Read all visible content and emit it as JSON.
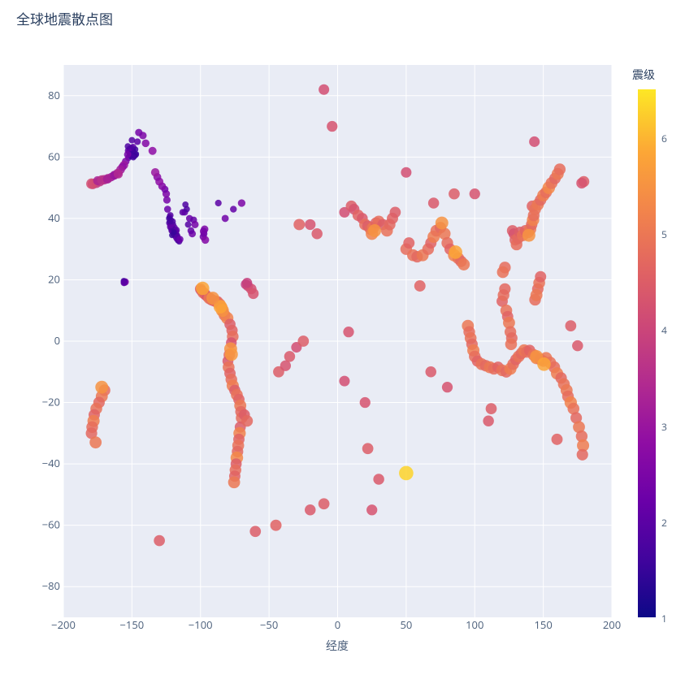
{
  "chart_data": {
    "type": "scatter",
    "title": "全球地震散点图",
    "xlabel": "经度",
    "ylabel": "",
    "xlim": [
      -200,
      200
    ],
    "ylim": [
      -90,
      90
    ],
    "xticks": [
      -200,
      -150,
      -100,
      -50,
      0,
      50,
      100,
      150,
      200
    ],
    "yticks": [
      -80,
      -60,
      -40,
      -20,
      0,
      20,
      40,
      60,
      80
    ],
    "color_axis": {
      "label": "震级",
      "min": 1,
      "max": 6.5,
      "ticks": [
        1,
        2,
        3,
        4,
        5,
        6
      ],
      "scale": "plasma"
    },
    "points": [
      [
        -149.9,
        60.5,
        1.5
      ],
      [
        -150.4,
        61.2,
        1.7
      ],
      [
        -148.3,
        60.1,
        1.3
      ],
      [
        -151.2,
        61.5,
        1.9
      ],
      [
        -152.5,
        59.8,
        2.0
      ],
      [
        -146.8,
        61.0,
        1.4
      ],
      [
        -150.1,
        62.3,
        1.8
      ],
      [
        -151.7,
        60.9,
        1.7
      ],
      [
        -149.2,
        63.2,
        2.1
      ],
      [
        -147.5,
        62.5,
        1.6
      ],
      [
        -152.0,
        61.8,
        1.9
      ],
      [
        -150.8,
        60.2,
        1.4
      ],
      [
        -148.9,
        61.9,
        1.5
      ],
      [
        -151.5,
        62.7,
        2.0
      ],
      [
        -149.6,
        61.3,
        1.7
      ],
      [
        -147.1,
        60.7,
        1.6
      ],
      [
        -150.3,
        63.0,
        1.8
      ],
      [
        -152.7,
        62.1,
        2.1
      ],
      [
        -148.0,
        60.4,
        1.5
      ],
      [
        -151.0,
        61.0,
        1.6
      ],
      [
        -153.1,
        60.8,
        2.4
      ],
      [
        -149.0,
        59.9,
        1.7
      ],
      [
        -154.5,
        58.6,
        2.5
      ],
      [
        -155.8,
        57.4,
        3.0
      ],
      [
        -156.9,
        56.8,
        2.8
      ],
      [
        -158.3,
        55.9,
        3.1
      ],
      [
        -160.5,
        54.7,
        3.3
      ],
      [
        -162.8,
        54.1,
        3.2
      ],
      [
        -165.0,
        53.5,
        3.0
      ],
      [
        -167.4,
        53.0,
        3.4
      ],
      [
        -170.2,
        52.6,
        3.6
      ],
      [
        -173.5,
        52.0,
        3.7
      ],
      [
        -176.0,
        51.5,
        3.8
      ],
      [
        -178.5,
        51.2,
        4.0
      ],
      [
        -179.5,
        51.3,
        4.2
      ],
      [
        -175.0,
        52.3,
        3.3
      ],
      [
        -172.0,
        52.5,
        3.6
      ],
      [
        -168.0,
        52.8,
        3.2
      ],
      [
        -163.0,
        54.0,
        3.0
      ],
      [
        -160.0,
        54.5,
        3.4
      ],
      [
        -155.0,
        19.3,
        2.5
      ],
      [
        -155.3,
        19.4,
        1.8
      ],
      [
        -155.5,
        19.2,
        2.2
      ],
      [
        -156.0,
        19.6,
        1.7
      ],
      [
        -155.8,
        19.0,
        2.0
      ],
      [
        -120.5,
        35.8,
        1.5
      ],
      [
        -121.2,
        36.5,
        1.8
      ],
      [
        -122.0,
        37.2,
        2.0
      ],
      [
        -119.5,
        34.8,
        1.7
      ],
      [
        -118.0,
        34.0,
        1.9
      ],
      [
        -117.2,
        33.5,
        2.2
      ],
      [
        -116.5,
        32.8,
        1.6
      ],
      [
        -118.5,
        36.0,
        2.1
      ],
      [
        -120.0,
        38.0,
        1.8
      ],
      [
        -121.5,
        39.5,
        1.5
      ],
      [
        -122.5,
        40.5,
        1.7
      ],
      [
        -117.0,
        34.5,
        1.6
      ],
      [
        -119.0,
        37.0,
        2.0
      ],
      [
        -121.0,
        36.0,
        1.9
      ],
      [
        -122.8,
        38.5,
        1.8
      ],
      [
        -116.0,
        33.0,
        2.0
      ],
      [
        -117.8,
        35.5,
        1.7
      ],
      [
        -120.8,
        34.5,
        1.5
      ],
      [
        -122.0,
        41.0,
        1.9
      ],
      [
        -123.0,
        40.0,
        1.6
      ],
      [
        -115.5,
        32.5,
        1.8
      ],
      [
        -119.8,
        36.5,
        1.7
      ],
      [
        -121.8,
        37.8,
        2.1
      ],
      [
        -118.8,
        35.0,
        1.6
      ],
      [
        -120.3,
        39.0,
        1.8
      ],
      [
        -117.5,
        36.2,
        2.0
      ],
      [
        -116.8,
        34.0,
        1.9
      ],
      [
        -122.3,
        39.0,
        1.7
      ],
      [
        -115.0,
        33.2,
        2.2
      ],
      [
        -119.3,
        35.5,
        1.5
      ],
      [
        -111.0,
        44.5,
        1.8
      ],
      [
        -113.0,
        42.0,
        2.0
      ],
      [
        -108.0,
        40.0,
        2.2
      ],
      [
        -105.0,
        39.5,
        2.1
      ],
      [
        -109.0,
        38.0,
        1.9
      ],
      [
        -111.5,
        42.0,
        2.0
      ],
      [
        -106.0,
        35.0,
        2.3
      ],
      [
        -107.0,
        36.0,
        2.1
      ],
      [
        -104.0,
        38.0,
        2.4
      ],
      [
        -110.0,
        43.0,
        1.8
      ],
      [
        -97.5,
        35.0,
        2.2
      ],
      [
        -97.0,
        36.5,
        2.5
      ],
      [
        -98.0,
        34.0,
        2.3
      ],
      [
        -96.5,
        33.0,
        2.6
      ],
      [
        -97.8,
        35.8,
        2.4
      ],
      [
        -87.0,
        45.0,
        2.0
      ],
      [
        -82.0,
        40.0,
        2.3
      ],
      [
        -76.0,
        43.0,
        2.1
      ],
      [
        -70.0,
        45.0,
        2.5
      ],
      [
        -100.0,
        17.0,
        4.5
      ],
      [
        -99.5,
        16.5,
        4.2
      ],
      [
        -98.0,
        15.8,
        4.8
      ],
      [
        -96.5,
        15.2,
        4.6
      ],
      [
        -95.0,
        14.5,
        4.3
      ],
      [
        -93.5,
        14.0,
        5.0
      ],
      [
        -92.0,
        13.5,
        4.7
      ],
      [
        -90.5,
        13.2,
        4.5
      ],
      [
        -89.0,
        13.0,
        4.8
      ],
      [
        -87.5,
        12.8,
        4.6
      ],
      [
        -86.0,
        12.0,
        4.9
      ],
      [
        -84.5,
        11.0,
        4.7
      ],
      [
        -83.5,
        9.5,
        4.4
      ],
      [
        -82.5,
        8.5,
        4.8
      ],
      [
        -80.5,
        7.5,
        5.2
      ],
      [
        -78.5,
        5.5,
        4.5
      ],
      [
        -77.0,
        3.5,
        4.6
      ],
      [
        -76.5,
        1.5,
        4.8
      ],
      [
        -77.5,
        -0.5,
        4.3
      ],
      [
        -78.0,
        -2.5,
        5.5
      ],
      [
        -79.0,
        -4.5,
        4.7
      ],
      [
        -80.0,
        -6.5,
        4.4
      ],
      [
        -79.5,
        -8.5,
        4.9
      ],
      [
        -78.5,
        -10.5,
        4.6
      ],
      [
        -77.5,
        -12.5,
        4.8
      ],
      [
        -76.5,
        -14.5,
        5.1
      ],
      [
        -75.0,
        -16.0,
        4.5
      ],
      [
        -73.5,
        -17.5,
        4.9
      ],
      [
        -72.0,
        -19.0,
        4.6
      ],
      [
        -71.0,
        -21.0,
        5.0
      ],
      [
        -70.5,
        -23.0,
        4.7
      ],
      [
        -70.0,
        -25.0,
        4.8
      ],
      [
        -71.0,
        -28.0,
        4.5
      ],
      [
        -71.5,
        -30.0,
        5.2
      ],
      [
        -72.0,
        -32.0,
        4.6
      ],
      [
        -72.5,
        -34.0,
        4.9
      ],
      [
        -73.0,
        -36.0,
        4.7
      ],
      [
        -73.5,
        -38.0,
        5.3
      ],
      [
        -74.0,
        -40.0,
        4.5
      ],
      [
        -74.5,
        -42.0,
        4.8
      ],
      [
        -75.0,
        -44.0,
        4.6
      ],
      [
        -75.5,
        -46.0,
        5.0
      ],
      [
        -68.0,
        -24.0,
        4.5
      ],
      [
        -66.0,
        -26.0,
        4.7
      ],
      [
        -84.0,
        10.0,
        5.5
      ],
      [
        -85.5,
        11.2,
        5.8
      ],
      [
        -91.0,
        14.0,
        5.5
      ],
      [
        -98.5,
        17.2,
        5.8
      ],
      [
        -77.5,
        -4.3,
        5.6
      ],
      [
        -67.0,
        18.5,
        3.8
      ],
      [
        -65.5,
        18.0,
        4.0
      ],
      [
        -63.0,
        17.0,
        4.2
      ],
      [
        -61.5,
        15.5,
        4.3
      ],
      [
        -66.0,
        19.0,
        3.9
      ],
      [
        -43.0,
        -10.0,
        4.5
      ],
      [
        -38.0,
        -8.0,
        4.3
      ],
      [
        -35.0,
        -5.0,
        4.4
      ],
      [
        -30.0,
        -2.0,
        4.2
      ],
      [
        -25.0,
        0.0,
        4.5
      ],
      [
        -28.0,
        38.0,
        4.6
      ],
      [
        -20.0,
        38.0,
        4.3
      ],
      [
        -15.0,
        35.0,
        4.4
      ],
      [
        -10.0,
        82.0,
        4.2
      ],
      [
        -4.0,
        70.0,
        4.3
      ],
      [
        5.0,
        42.0,
        4.2
      ],
      [
        10.0,
        44.0,
        4.5
      ],
      [
        12.0,
        43.0,
        4.3
      ],
      [
        15.0,
        41.0,
        4.6
      ],
      [
        18.0,
        40.0,
        4.4
      ],
      [
        20.0,
        38.0,
        4.8
      ],
      [
        22.0,
        37.5,
        4.5
      ],
      [
        24.0,
        36.5,
        4.7
      ],
      [
        26.0,
        37.0,
        5.0
      ],
      [
        28.0,
        38.5,
        4.6
      ],
      [
        30.0,
        39.0,
        4.8
      ],
      [
        33.0,
        38.0,
        4.5
      ],
      [
        36.0,
        36.0,
        4.9
      ],
      [
        38.0,
        38.0,
        4.7
      ],
      [
        40.0,
        40.0,
        4.6
      ],
      [
        42.0,
        42.0,
        4.5
      ],
      [
        25.0,
        35.0,
        5.2
      ],
      [
        27.0,
        36.0,
        5.5
      ],
      [
        8.0,
        3.0,
        4.3
      ],
      [
        5.0,
        -13.0,
        4.2
      ],
      [
        20.0,
        -20.0,
        4.3
      ],
      [
        22.0,
        -35.0,
        4.5
      ],
      [
        30.0,
        -45.0,
        4.4
      ],
      [
        25.0,
        -55.0,
        4.3
      ],
      [
        -10.0,
        -53.0,
        4.5
      ],
      [
        -20.0,
        -55.0,
        4.4
      ],
      [
        -45.0,
        -60.0,
        4.6
      ],
      [
        -60.0,
        -62.0,
        4.5
      ],
      [
        50.0,
        30.0,
        4.8
      ],
      [
        52.0,
        32.0,
        4.6
      ],
      [
        55.0,
        28.0,
        4.9
      ],
      [
        58.0,
        27.5,
        4.7
      ],
      [
        62.0,
        28.0,
        5.0
      ],
      [
        66.0,
        30.0,
        4.8
      ],
      [
        68.0,
        32.0,
        4.6
      ],
      [
        70.0,
        34.0,
        5.1
      ],
      [
        72.0,
        36.0,
        4.9
      ],
      [
        75.0,
        37.0,
        4.7
      ],
      [
        78.0,
        35.0,
        5.0
      ],
      [
        80.0,
        32.0,
        4.8
      ],
      [
        82.0,
        30.0,
        4.6
      ],
      [
        85.0,
        28.0,
        5.2
      ],
      [
        88.0,
        27.0,
        4.9
      ],
      [
        90.0,
        26.0,
        4.7
      ],
      [
        92.0,
        25.0,
        5.0
      ],
      [
        76.0,
        38.5,
        5.5
      ],
      [
        86.0,
        29.0,
        5.8
      ],
      [
        95.0,
        5.0,
        5.0
      ],
      [
        96.0,
        3.0,
        4.8
      ],
      [
        97.0,
        1.0,
        4.9
      ],
      [
        98.0,
        -1.0,
        4.7
      ],
      [
        99.0,
        -3.0,
        5.1
      ],
      [
        100.0,
        -5.0,
        4.8
      ],
      [
        102.0,
        -6.5,
        4.6
      ],
      [
        105.0,
        -7.5,
        4.9
      ],
      [
        108.0,
        -8.0,
        4.7
      ],
      [
        111.0,
        -8.5,
        5.0
      ],
      [
        114.0,
        -9.0,
        4.8
      ],
      [
        117.0,
        -8.5,
        4.6
      ],
      [
        120.0,
        -9.5,
        4.9
      ],
      [
        123.0,
        -10.0,
        4.7
      ],
      [
        126.0,
        -9.0,
        5.1
      ],
      [
        128.0,
        -7.5,
        4.8
      ],
      [
        130.0,
        -6.0,
        4.6
      ],
      [
        132.0,
        -5.0,
        4.9
      ],
      [
        134.0,
        -4.0,
        4.7
      ],
      [
        136.0,
        -3.0,
        5.0
      ],
      [
        138.0,
        -3.5,
        4.8
      ],
      [
        140.0,
        -3.0,
        4.6
      ],
      [
        143.0,
        -4.5,
        4.9
      ],
      [
        145.0,
        -5.5,
        5.2
      ],
      [
        148.0,
        -6.0,
        4.8
      ],
      [
        150.0,
        -6.5,
        4.7
      ],
      [
        152.0,
        -5.5,
        5.0
      ],
      [
        155.0,
        -7.0,
        4.9
      ],
      [
        158.0,
        -8.5,
        4.8
      ],
      [
        160.0,
        -10.5,
        5.1
      ],
      [
        163.0,
        -12.0,
        4.7
      ],
      [
        165.0,
        -14.0,
        4.9
      ],
      [
        167.0,
        -16.0,
        5.0
      ],
      [
        168.0,
        -18.0,
        4.8
      ],
      [
        170.0,
        -20.0,
        5.2
      ],
      [
        172.0,
        -22.0,
        4.9
      ],
      [
        174.0,
        -25.0,
        4.7
      ],
      [
        176.0,
        -28.0,
        5.0
      ],
      [
        145.0,
        -5.0,
        5.5
      ],
      [
        150.5,
        -7.5,
        5.8
      ],
      [
        178.0,
        -31.0,
        4.8
      ],
      [
        179.0,
        -34.0,
        5.1
      ],
      [
        178.5,
        -37.0,
        4.7
      ],
      [
        122.0,
        24.0,
        4.8
      ],
      [
        120.0,
        13.0,
        4.6
      ],
      [
        121.0,
        15.0,
        4.8
      ],
      [
        122.0,
        17.0,
        4.7
      ],
      [
        123.0,
        10.0,
        4.9
      ],
      [
        124.0,
        8.0,
        4.6
      ],
      [
        125.0,
        6.0,
        5.0
      ],
      [
        126.0,
        3.0,
        4.8
      ],
      [
        127.0,
        1.0,
        4.7
      ],
      [
        126.5,
        -1.0,
        4.9
      ],
      [
        120.5,
        22.5,
        4.9
      ],
      [
        127.5,
        36.0,
        4.5
      ],
      [
        128.5,
        35.0,
        4.3
      ],
      [
        129.5,
        33.0,
        4.6
      ],
      [
        130.5,
        31.5,
        4.8
      ],
      [
        131.5,
        33.5,
        4.7
      ],
      [
        133.0,
        35.5,
        4.5
      ],
      [
        135.0,
        34.5,
        4.9
      ],
      [
        137.0,
        36.0,
        4.6
      ],
      [
        139.0,
        35.5,
        4.8
      ],
      [
        140.5,
        36.5,
        5.0
      ],
      [
        141.5,
        38.0,
        4.7
      ],
      [
        142.5,
        39.5,
        5.2
      ],
      [
        143.0,
        41.0,
        4.8
      ],
      [
        142.0,
        44.0,
        4.6
      ],
      [
        144.0,
        43.0,
        4.9
      ],
      [
        146.0,
        44.5,
        5.0
      ],
      [
        148.0,
        46.0,
        4.7
      ],
      [
        150.0,
        47.5,
        5.1
      ],
      [
        152.0,
        48.5,
        4.8
      ],
      [
        154.0,
        50.0,
        5.3
      ],
      [
        156.0,
        51.5,
        4.9
      ],
      [
        158.5,
        53.0,
        4.7
      ],
      [
        160.5,
        54.5,
        5.0
      ],
      [
        162.0,
        56.0,
        4.8
      ],
      [
        144.0,
        13.5,
        4.8
      ],
      [
        146.0,
        17.0,
        4.7
      ],
      [
        147.0,
        19.0,
        4.9
      ],
      [
        148.0,
        21.0,
        4.6
      ],
      [
        145.0,
        15.0,
        5.0
      ],
      [
        139.5,
        34.5,
        5.5
      ],
      [
        179.5,
        52.0,
        4.5
      ],
      [
        178.0,
        51.5,
        4.3
      ],
      [
        175.0,
        -1.5,
        4.4
      ],
      [
        170.0,
        5.0,
        4.5
      ],
      [
        160.0,
        -32.0,
        4.6
      ],
      [
        110.0,
        -26.0,
        4.4
      ],
      [
        112.0,
        -22.0,
        4.5
      ],
      [
        80.0,
        -15.0,
        4.3
      ],
      [
        68.0,
        -10.0,
        4.4
      ],
      [
        60.0,
        18.0,
        4.6
      ],
      [
        50.0,
        -43.0,
        6.3
      ],
      [
        143.5,
        65.0,
        4.2
      ],
      [
        100.0,
        48.0,
        4.3
      ],
      [
        85.0,
        48.0,
        4.5
      ],
      [
        70.0,
        45.0,
        4.4
      ],
      [
        50.0,
        55.0,
        4.2
      ],
      [
        -142.0,
        67.0,
        2.5
      ],
      [
        -135.0,
        62.0,
        2.8
      ],
      [
        -140.0,
        64.5,
        2.6
      ],
      [
        -145.0,
        68.0,
        2.4
      ],
      [
        -153.0,
        63.5,
        1.8
      ],
      [
        -146.0,
        65.0,
        2.0
      ],
      [
        -150.0,
        65.5,
        1.9
      ],
      [
        -170.0,
        -16.0,
        4.8
      ],
      [
        -172.0,
        -18.0,
        5.0
      ],
      [
        -174.0,
        -20.0,
        4.7
      ],
      [
        -176.0,
        -22.0,
        4.9
      ],
      [
        -177.5,
        -24.0,
        4.6
      ],
      [
        -178.0,
        -26.0,
        5.1
      ],
      [
        -179.0,
        -28.0,
        4.8
      ],
      [
        -179.5,
        -30.0,
        4.7
      ],
      [
        -176.5,
        -33.0,
        5.0
      ],
      [
        -172.0,
        -15.0,
        5.5
      ],
      [
        -130.0,
        -65.0,
        4.5
      ],
      [
        -124.0,
        43.0,
        2.2
      ],
      [
        -124.5,
        46.0,
        2.4
      ],
      [
        -125.0,
        48.0,
        2.5
      ],
      [
        -126.0,
        49.5,
        2.3
      ],
      [
        -128.0,
        50.5,
        2.6
      ],
      [
        -130.0,
        52.0,
        2.8
      ],
      [
        -131.5,
        53.5,
        2.7
      ],
      [
        -133.0,
        55.0,
        3.0
      ]
    ]
  }
}
